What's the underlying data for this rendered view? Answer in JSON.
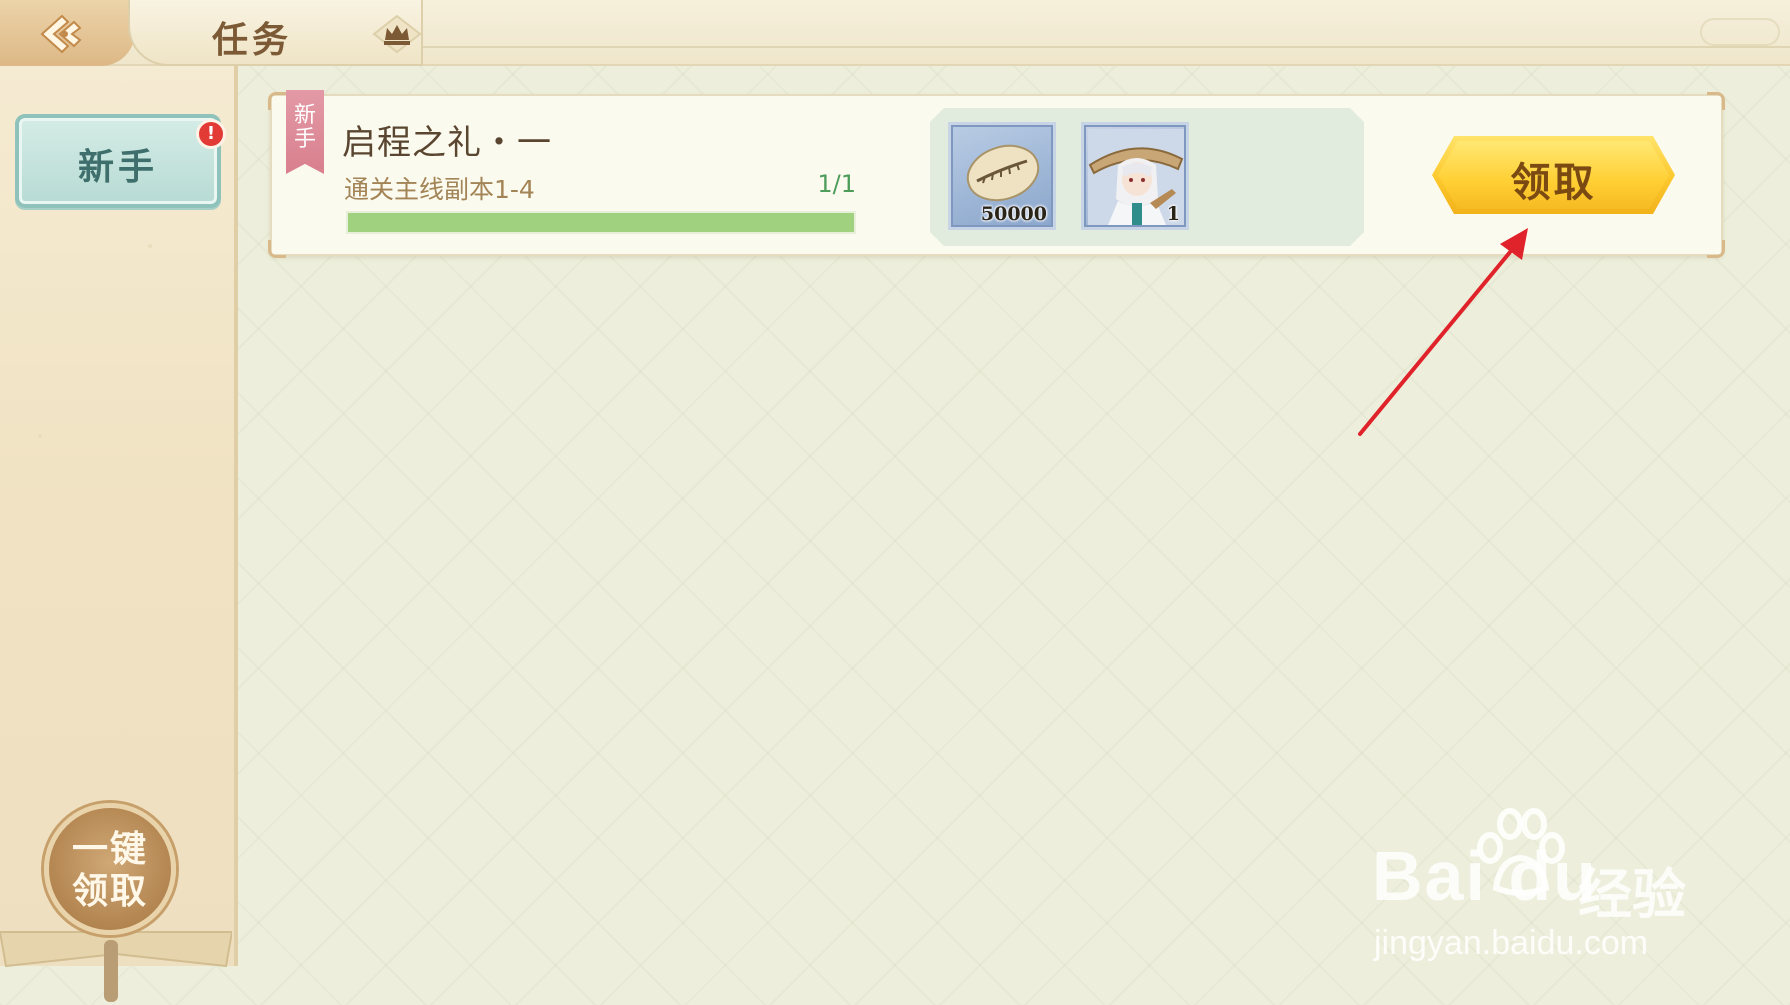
{
  "header": {
    "title": "任务"
  },
  "sidebar": {
    "tabs": [
      {
        "label": "新手",
        "has_alert": true,
        "alert_symbol": "!"
      }
    ],
    "claim_all_label_line1": "一键",
    "claim_all_label_line2": "领取"
  },
  "tasks": [
    {
      "tag": "新手",
      "title": "启程之礼・一",
      "description": "通关主线副本1-4",
      "progress_text": "1/1",
      "progress_fraction": 1.0,
      "rewards": [
        {
          "icon": "cowrie-shell-icon",
          "count": "50000"
        },
        {
          "icon": "character-portrait-icon",
          "count": "1"
        }
      ],
      "claim_label": "领取"
    }
  ],
  "watermark": {
    "logo": "Bai du",
    "cn": "经验",
    "url": "jingyan.baidu.com"
  },
  "colors": {
    "accent_gold": "#fcc82d",
    "progress_green": "#9fd17f",
    "tab_teal": "#b7dbd4",
    "alert_red": "#e23a35",
    "annotation_arrow": "#e0232a"
  }
}
